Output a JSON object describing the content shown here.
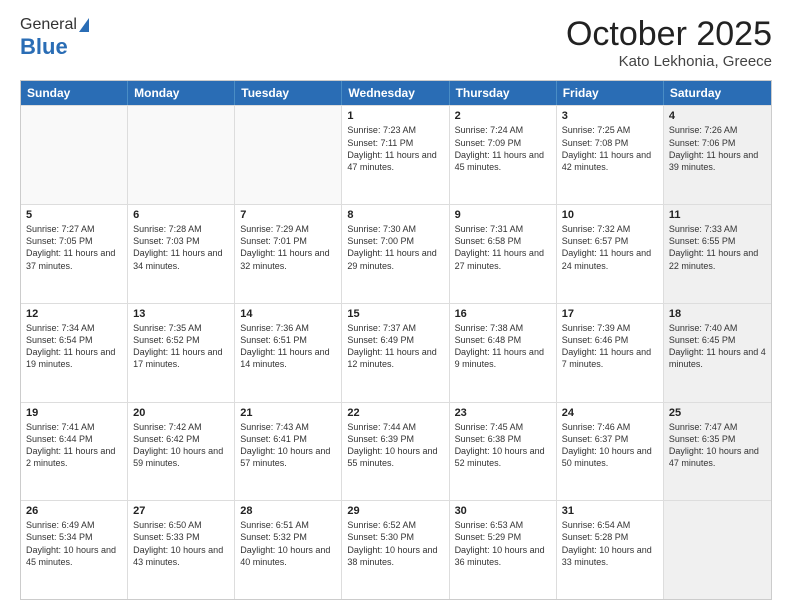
{
  "header": {
    "logo_general": "General",
    "logo_blue": "Blue",
    "month_title": "October 2025",
    "location": "Kato Lekhonia, Greece"
  },
  "days_of_week": [
    "Sunday",
    "Monday",
    "Tuesday",
    "Wednesday",
    "Thursday",
    "Friday",
    "Saturday"
  ],
  "rows": [
    [
      {
        "day": "",
        "empty": true
      },
      {
        "day": "",
        "empty": true
      },
      {
        "day": "",
        "empty": true
      },
      {
        "day": "1",
        "rise": "Sunrise: 7:23 AM",
        "set": "Sunset: 7:11 PM",
        "light": "Daylight: 11 hours and 47 minutes."
      },
      {
        "day": "2",
        "rise": "Sunrise: 7:24 AM",
        "set": "Sunset: 7:09 PM",
        "light": "Daylight: 11 hours and 45 minutes."
      },
      {
        "day": "3",
        "rise": "Sunrise: 7:25 AM",
        "set": "Sunset: 7:08 PM",
        "light": "Daylight: 11 hours and 42 minutes."
      },
      {
        "day": "4",
        "rise": "Sunrise: 7:26 AM",
        "set": "Sunset: 7:06 PM",
        "light": "Daylight: 11 hours and 39 minutes.",
        "shaded": true
      }
    ],
    [
      {
        "day": "5",
        "rise": "Sunrise: 7:27 AM",
        "set": "Sunset: 7:05 PM",
        "light": "Daylight: 11 hours and 37 minutes."
      },
      {
        "day": "6",
        "rise": "Sunrise: 7:28 AM",
        "set": "Sunset: 7:03 PM",
        "light": "Daylight: 11 hours and 34 minutes."
      },
      {
        "day": "7",
        "rise": "Sunrise: 7:29 AM",
        "set": "Sunset: 7:01 PM",
        "light": "Daylight: 11 hours and 32 minutes."
      },
      {
        "day": "8",
        "rise": "Sunrise: 7:30 AM",
        "set": "Sunset: 7:00 PM",
        "light": "Daylight: 11 hours and 29 minutes."
      },
      {
        "day": "9",
        "rise": "Sunrise: 7:31 AM",
        "set": "Sunset: 6:58 PM",
        "light": "Daylight: 11 hours and 27 minutes."
      },
      {
        "day": "10",
        "rise": "Sunrise: 7:32 AM",
        "set": "Sunset: 6:57 PM",
        "light": "Daylight: 11 hours and 24 minutes."
      },
      {
        "day": "11",
        "rise": "Sunrise: 7:33 AM",
        "set": "Sunset: 6:55 PM",
        "light": "Daylight: 11 hours and 22 minutes.",
        "shaded": true
      }
    ],
    [
      {
        "day": "12",
        "rise": "Sunrise: 7:34 AM",
        "set": "Sunset: 6:54 PM",
        "light": "Daylight: 11 hours and 19 minutes."
      },
      {
        "day": "13",
        "rise": "Sunrise: 7:35 AM",
        "set": "Sunset: 6:52 PM",
        "light": "Daylight: 11 hours and 17 minutes."
      },
      {
        "day": "14",
        "rise": "Sunrise: 7:36 AM",
        "set": "Sunset: 6:51 PM",
        "light": "Daylight: 11 hours and 14 minutes."
      },
      {
        "day": "15",
        "rise": "Sunrise: 7:37 AM",
        "set": "Sunset: 6:49 PM",
        "light": "Daylight: 11 hours and 12 minutes."
      },
      {
        "day": "16",
        "rise": "Sunrise: 7:38 AM",
        "set": "Sunset: 6:48 PM",
        "light": "Daylight: 11 hours and 9 minutes."
      },
      {
        "day": "17",
        "rise": "Sunrise: 7:39 AM",
        "set": "Sunset: 6:46 PM",
        "light": "Daylight: 11 hours and 7 minutes."
      },
      {
        "day": "18",
        "rise": "Sunrise: 7:40 AM",
        "set": "Sunset: 6:45 PM",
        "light": "Daylight: 11 hours and 4 minutes.",
        "shaded": true
      }
    ],
    [
      {
        "day": "19",
        "rise": "Sunrise: 7:41 AM",
        "set": "Sunset: 6:44 PM",
        "light": "Daylight: 11 hours and 2 minutes."
      },
      {
        "day": "20",
        "rise": "Sunrise: 7:42 AM",
        "set": "Sunset: 6:42 PM",
        "light": "Daylight: 10 hours and 59 minutes."
      },
      {
        "day": "21",
        "rise": "Sunrise: 7:43 AM",
        "set": "Sunset: 6:41 PM",
        "light": "Daylight: 10 hours and 57 minutes."
      },
      {
        "day": "22",
        "rise": "Sunrise: 7:44 AM",
        "set": "Sunset: 6:39 PM",
        "light": "Daylight: 10 hours and 55 minutes."
      },
      {
        "day": "23",
        "rise": "Sunrise: 7:45 AM",
        "set": "Sunset: 6:38 PM",
        "light": "Daylight: 10 hours and 52 minutes."
      },
      {
        "day": "24",
        "rise": "Sunrise: 7:46 AM",
        "set": "Sunset: 6:37 PM",
        "light": "Daylight: 10 hours and 50 minutes."
      },
      {
        "day": "25",
        "rise": "Sunrise: 7:47 AM",
        "set": "Sunset: 6:35 PM",
        "light": "Daylight: 10 hours and 47 minutes.",
        "shaded": true
      }
    ],
    [
      {
        "day": "26",
        "rise": "Sunrise: 6:49 AM",
        "set": "Sunset: 5:34 PM",
        "light": "Daylight: 10 hours and 45 minutes."
      },
      {
        "day": "27",
        "rise": "Sunrise: 6:50 AM",
        "set": "Sunset: 5:33 PM",
        "light": "Daylight: 10 hours and 43 minutes."
      },
      {
        "day": "28",
        "rise": "Sunrise: 6:51 AM",
        "set": "Sunset: 5:32 PM",
        "light": "Daylight: 10 hours and 40 minutes."
      },
      {
        "day": "29",
        "rise": "Sunrise: 6:52 AM",
        "set": "Sunset: 5:30 PM",
        "light": "Daylight: 10 hours and 38 minutes."
      },
      {
        "day": "30",
        "rise": "Sunrise: 6:53 AM",
        "set": "Sunset: 5:29 PM",
        "light": "Daylight: 10 hours and 36 minutes."
      },
      {
        "day": "31",
        "rise": "Sunrise: 6:54 AM",
        "set": "Sunset: 5:28 PM",
        "light": "Daylight: 10 hours and 33 minutes."
      },
      {
        "day": "",
        "empty": true,
        "shaded": true
      }
    ]
  ]
}
